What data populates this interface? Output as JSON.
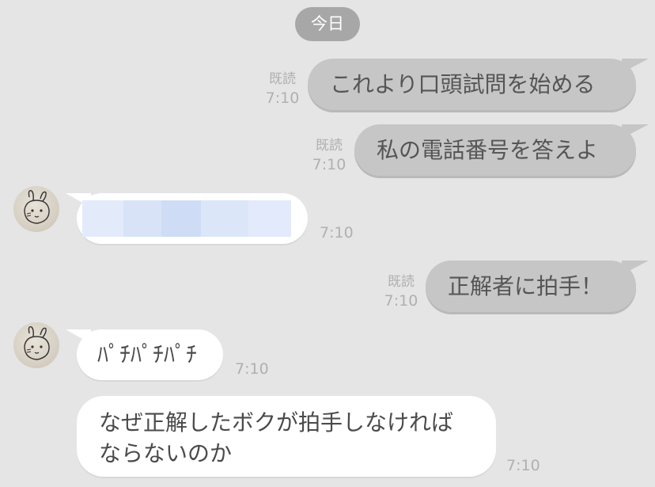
{
  "date_separator": "今日",
  "messages": [
    {
      "side": "out",
      "text": "これより口頭試問を始める",
      "read": "既読",
      "time": "7:10"
    },
    {
      "side": "out",
      "text": "私の電話番号を答えよ",
      "read": "既読",
      "time": "7:10"
    },
    {
      "side": "in",
      "text": "",
      "time": "7:10",
      "redacted": true
    },
    {
      "side": "out",
      "text": "正解者に拍手！",
      "read": "既読",
      "time": "7:10"
    },
    {
      "side": "in",
      "text": "ﾊﾟﾁﾊﾟﾁﾊﾟﾁ",
      "time": "7:10"
    },
    {
      "side": "in",
      "text_lines": [
        "なぜ正解したボクが拍手しなければ",
        "ならないのか"
      ],
      "time": "7:10"
    }
  ]
}
